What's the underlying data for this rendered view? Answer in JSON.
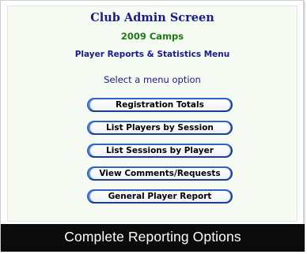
{
  "header": {
    "title": "Club Admin Screen",
    "subtitle": "2009 Camps",
    "menu_heading": "Player Reports & Statistics Menu"
  },
  "prompt": "Select a menu option",
  "menu": {
    "buttons": [
      {
        "label": "Registration Totals"
      },
      {
        "label": "List Players by Session"
      },
      {
        "label": "List Sessions by Player"
      },
      {
        "label": "View Comments/Requests"
      },
      {
        "label": "General Player Report"
      }
    ]
  },
  "caption": "Complete Reporting Options",
  "colors": {
    "title": "#1a1a8c",
    "subtitle": "#1e7a12",
    "panel_bg": "#f5faf3",
    "button_border": "#2f63c9",
    "caption_bar": "#0b0b0b"
  }
}
